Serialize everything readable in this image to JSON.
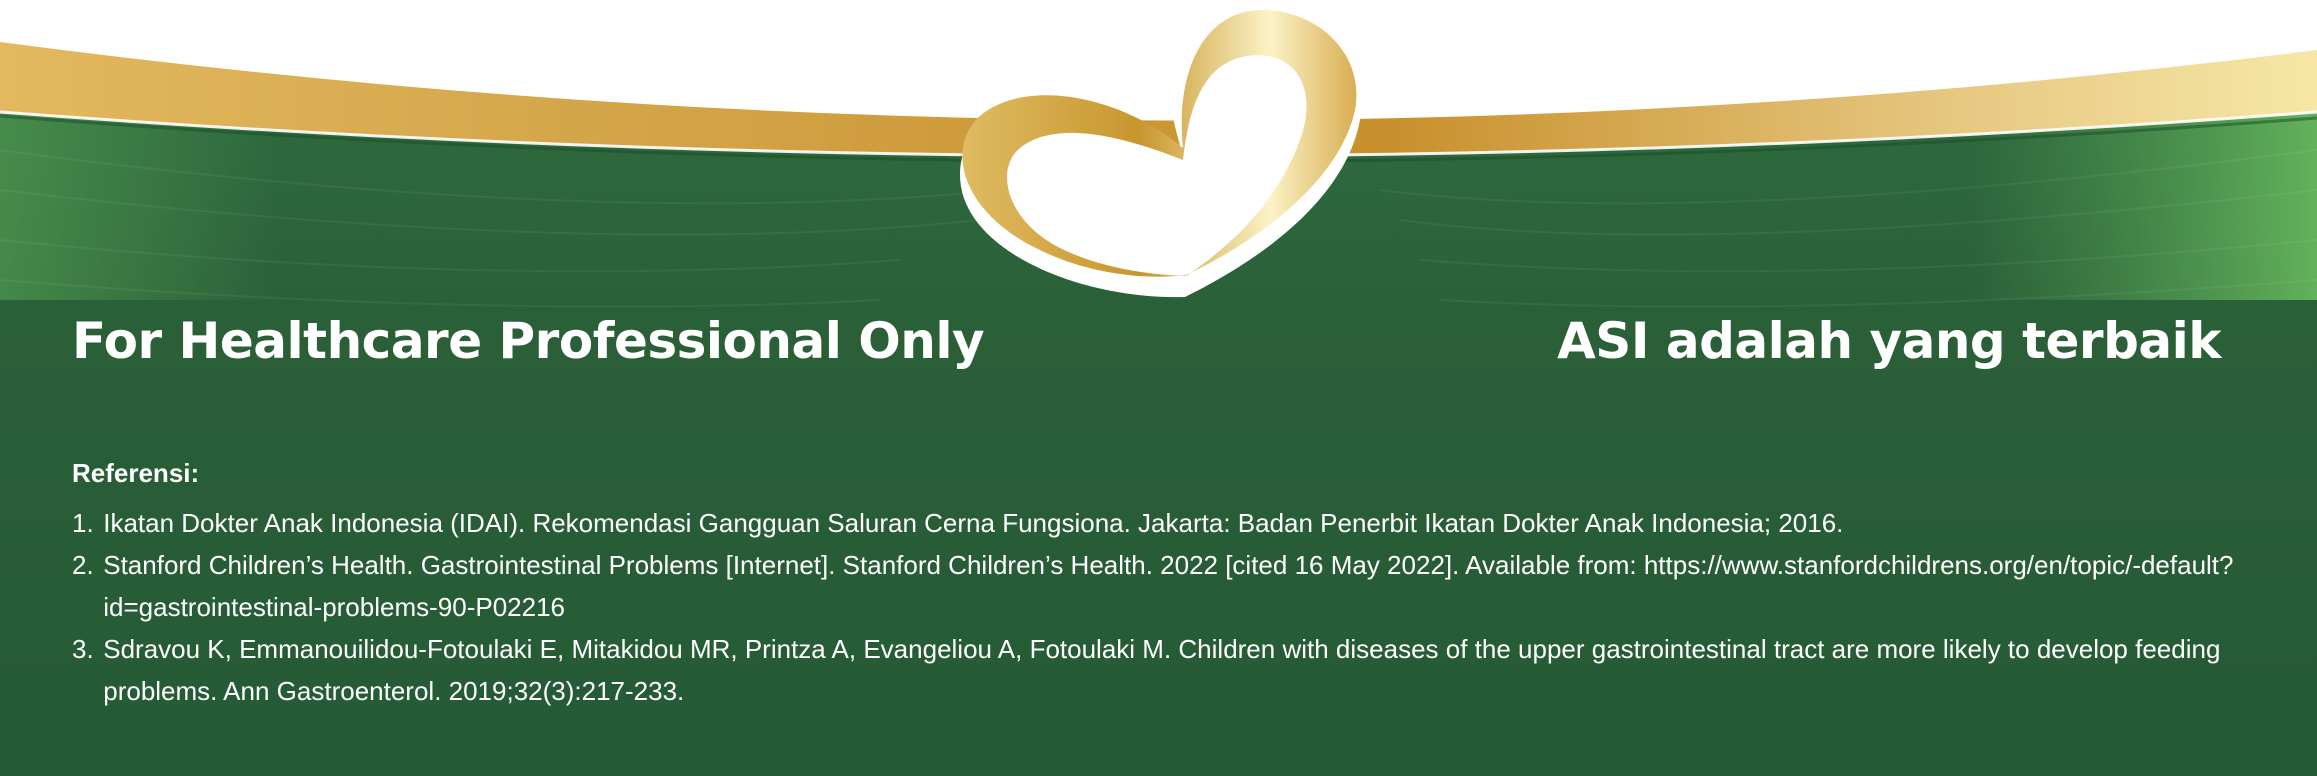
{
  "banner": {
    "left_headline": "For Healthcare Professional Only",
    "right_headline": "ASI adalah yang terbaik",
    "logo_icon": "heart-icon",
    "colors": {
      "green_dark": "#245a35",
      "green_mid": "#2e6a3e",
      "green_light": "#5aa858",
      "gold": "#c8962e",
      "gold_light": "#f6e7a6",
      "text": "#ffffff"
    }
  },
  "references": {
    "heading": "Referensi:",
    "items": [
      {
        "number": "1.",
        "text": "Ikatan Dokter Anak Indonesia (IDAI). Rekomendasi Gangguan Saluran Cerna Fungsiona. Jakarta: Badan Penerbit Ikatan Dokter Anak Indonesia; 2016."
      },
      {
        "number": "2.",
        "text": "Stanford Children’s Health. Gastrointestinal Problems [Internet]. Stanford Children’s Health. 2022 [cited 16 May 2022]. Available from: https://www.stanfordchildrens.org/en/topic/-default?id=gastrointestinal-problems-90-P02216"
      },
      {
        "number": "3.",
        "text": "Sdravou K, Emmanouilidou-Fotoulaki E, Mitakidou MR, Printza A, Evangeliou A, Fotoulaki M. Children with diseases of the upper gastrointestinal tract are more likely to develop feeding problems. Ann Gastroenterol. 2019;32(3):217-233."
      }
    ]
  }
}
